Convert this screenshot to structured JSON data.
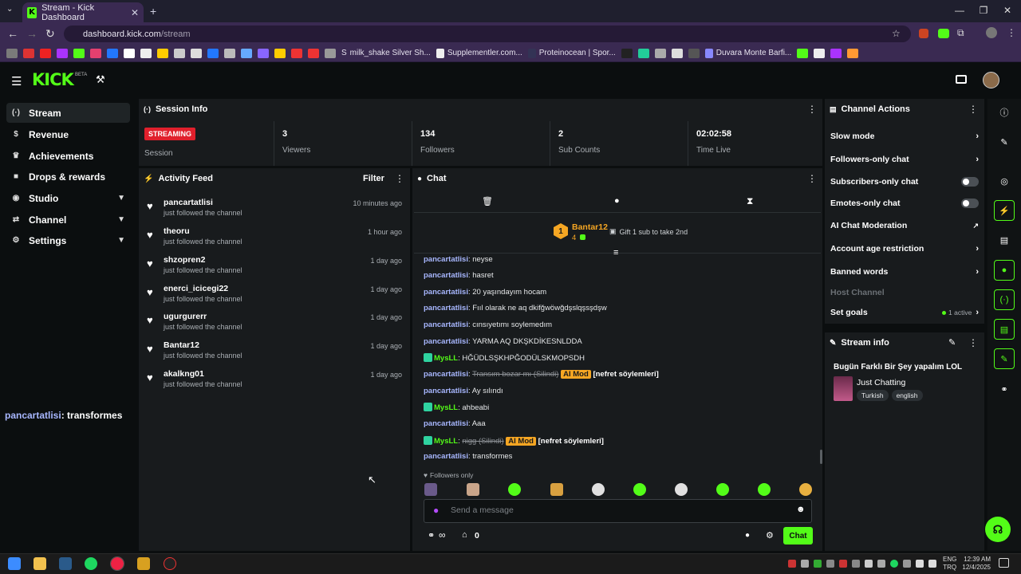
{
  "browser": {
    "tab_title": "Stream - Kick Dashboard",
    "tab_close": "✕",
    "new_tab": "+",
    "url_host": "dashboard.kick.com",
    "url_path": "/stream",
    "bookmarks": [
      "milk_shake Silver Sh...",
      "Supplementler.com...",
      "Proteinocean | Spor...",
      "Duvara Monte Barfi..."
    ]
  },
  "header": {
    "logo": "KICK",
    "beta": "BETA"
  },
  "sidebar": {
    "items": [
      {
        "label": "Stream",
        "icon": "broadcast-icon"
      },
      {
        "label": "Revenue",
        "icon": "dollar-icon"
      },
      {
        "label": "Achievements",
        "icon": "trophy-icon"
      },
      {
        "label": "Drops & rewards",
        "icon": "gift-icon"
      },
      {
        "label": "Studio",
        "icon": "studio-icon"
      },
      {
        "label": "Channel",
        "icon": "channel-icon"
      },
      {
        "label": "Settings",
        "icon": "gear-icon"
      }
    ],
    "overlay_name": "pancartatlisi",
    "overlay_msg": ": transformes"
  },
  "session": {
    "title": "Session Info",
    "status": "STREAMING",
    "status_label": "Session",
    "stats": [
      {
        "value": "3",
        "label": "Viewers"
      },
      {
        "value": "134",
        "label": "Followers"
      },
      {
        "value": "2",
        "label": "Sub Counts"
      },
      {
        "value": "02:02:58",
        "label": "Time Live"
      }
    ]
  },
  "activity": {
    "title": "Activity Feed",
    "filter": "Filter",
    "items": [
      {
        "name": "pancartatlisi",
        "action": "just followed the channel",
        "time": "10 minutes ago"
      },
      {
        "name": "theoru",
        "action": "just followed the channel",
        "time": "1 hour ago"
      },
      {
        "name": "shzopren2",
        "action": "just followed the channel",
        "time": "1 day ago"
      },
      {
        "name": "enerci_icicegi22",
        "action": "just followed the channel",
        "time": "1 day ago"
      },
      {
        "name": "ugurgurerr",
        "action": "just followed the channel",
        "time": "1 day ago"
      },
      {
        "name": "Bantar12",
        "action": "just followed the channel",
        "time": "1 day ago"
      },
      {
        "name": "akalkng01",
        "action": "just followed the channel",
        "time": "1 day ago"
      }
    ]
  },
  "chat": {
    "title": "Chat",
    "leader_rank": "1",
    "leader_name": "Bantar12",
    "leader_count": "4",
    "gift_text": "Gift 1 sub to take 2nd",
    "messages": [
      {
        "user": "pancartatlisi",
        "text": ": neyse"
      },
      {
        "user": "pancartatlisi",
        "text": ": hasret"
      },
      {
        "user": "pancartatlisi",
        "text": ": 20 yaşındayım hocam"
      },
      {
        "user": "pancartatlisi",
        "text": ": Fııl olarak ne aq dkifğwöwğdşslqşsşdşw"
      },
      {
        "user": "pancartatlisi",
        "text": ": cınsıyetımı soylemedım"
      },
      {
        "user": "pancartatlisi",
        "text": ": YARMA AQ DKŞKDİKESNLDDA"
      },
      {
        "user": "MysLL",
        "text": ": HĞÜDLSŞKHPĞODÜLSKMOPSDH"
      },
      {
        "user": "pancartatlisi",
        "deleted": "Transım bozar mı (Silindi)",
        "mod": "AI Mod",
        "reason": "[nefret söylemleri]"
      },
      {
        "user": "pancartatlisi",
        "text": ": Ay sılındı"
      },
      {
        "user": "MysLL",
        "text": ": ahbeabi"
      },
      {
        "user": "pancartatlisi",
        "text": ": Aaa"
      },
      {
        "user": "MysLL",
        "deleted": "nigg (Silindi)",
        "mod": "AI Mod",
        "reason": "[nefret söylemleri]"
      },
      {
        "user": "pancartatlisi",
        "text": ": transformes"
      }
    ],
    "followers_only": "Followers only",
    "placeholder": "Send a message",
    "infinity": "∞",
    "count": "0",
    "send_label": "Chat"
  },
  "actions": {
    "title": "Channel Actions",
    "items": [
      {
        "label": "Slow mode",
        "control": "chevron"
      },
      {
        "label": "Followers-only chat",
        "control": "chevron"
      },
      {
        "label": "Subscribers-only chat",
        "control": "toggle"
      },
      {
        "label": "Emotes-only chat",
        "control": "toggle"
      },
      {
        "label": "AI Chat Moderation",
        "control": "external"
      },
      {
        "label": "Account age restriction",
        "control": "chevron"
      },
      {
        "label": "Banned words",
        "control": "chevron"
      },
      {
        "label": "Host Channel",
        "control": "none"
      },
      {
        "label": "Set goals",
        "control": "chevron"
      }
    ],
    "goals_active": "1 active"
  },
  "stream_info": {
    "title": "Stream info",
    "stream_title": "Bugün Farklı Bir Şey yapalım LOL",
    "category": "Just Chatting",
    "tags": [
      "Turkish",
      "english"
    ]
  },
  "taskbar": {
    "lang1": "ENG",
    "lang2": "TRQ",
    "time": "12:39 AM",
    "date": "12/4/2025"
  },
  "colors": {
    "accent": "#53fc18",
    "streaming": "#e0202c",
    "panel": "#181b1d"
  }
}
